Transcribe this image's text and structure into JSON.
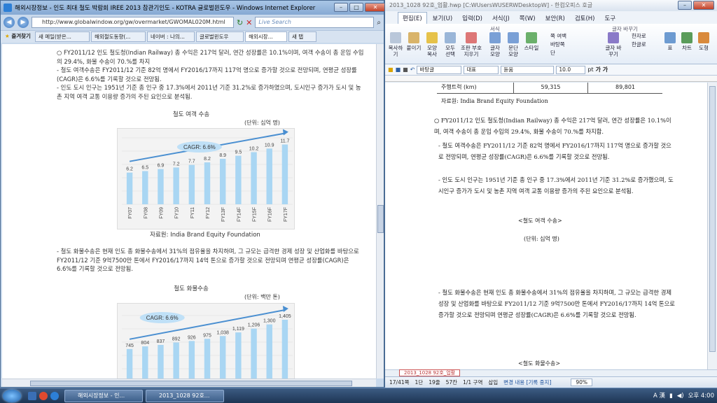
{
  "ie": {
    "title": "해외시장정보 - 인도 최대 철도 박람회 IREE 2013 참관기인도 - KOTRA 글로벌윈도우 - Windows Internet Explorer",
    "url": "http://www.globalwindow.org/gw/overmarket/GWOMAL020M.html",
    "search_placeholder": "Live Search",
    "favorites_label": "즐겨찾기",
    "tabs": [
      "새 메일(받은...",
      "해외철도동향(...",
      "네이버 : 나의...",
      "글로벌윈도우",
      "해외시장...",
      "새 탭"
    ],
    "content": {
      "bullet1": "○ FY2011/12 인도 철도청(Indian Railway) 총 수익은 217억 달러, 연간 성장률은 10.1%이며, 여객 수송이 총 운임 수입의 29.4%, 화물 수송이 70.%를 차지",
      "dash1": "- 철도 여객수송은 FY2011/12 기준 82억 명에서 FY2016/17까지 117억 명으로 증가할 것으로 전망되며, 연평균 성장률(CAGR)은 6.6%를 기록할 것으로 전망됨.",
      "dash2": "- 인도 도시 인구는 1951년 기준 총 인구 중 17.3%에서 2011년 기준 31.2%로 증가하였으며, 도시인구 증가가 도시 및 농촌 지역 여객 교통 이용량 증가의 주된 요인으로 분석됨.",
      "chart1_title": "철도 여객 수송",
      "chart1_unit": "(단위: 십억 명)",
      "chart1_source": "자료원: India Brand Equity Foundation",
      "dash3": "- 철도 화물수송은 현재 인도 총 화물수송에서 31%의 점유율을 차지하며, 그 규모는 급격한 경제 성장 및 산업화를 바탕으로 FY2011/12 기준 9억7500만 톤에서 FY2016/17까지 14억 톤으로 증가할 것으로 전망되며 연평균 성장률(CAGR)은 6.6%를 기록할 것으로 전망됨.",
      "chart2_title": "철도 화물수송",
      "chart2_unit": "(단위: 백만 톤)"
    }
  },
  "chart_data": [
    {
      "type": "bar",
      "title": "철도 여객 수송",
      "ylabel": "(단위: 십억 명)",
      "annotation": "CAGR: 6.6%",
      "categories": [
        "FY07",
        "FY08",
        "FY09",
        "FY10",
        "FY11",
        "FY12",
        "FY13F",
        "FY14F",
        "FY15F",
        "FY16F",
        "FY17F"
      ],
      "values": [
        6.2,
        6.5,
        6.9,
        7.2,
        7.7,
        8.2,
        8.9,
        9.5,
        10.2,
        10.9,
        11.7
      ],
      "labels": [
        "6.2",
        "6.5",
        "6.9",
        "7.2",
        "7.7",
        "8.2",
        "8.9",
        "9.5",
        "10.2",
        "10.9",
        "11.7"
      ],
      "ylim": [
        0,
        13
      ]
    },
    {
      "type": "bar",
      "title": "철도 화물수송",
      "ylabel": "(단위: 백만 톤)",
      "annotation": "CAGR: 6.6%",
      "values": [
        745,
        804,
        837,
        892,
        926,
        975,
        1038,
        1119,
        1206,
        1300,
        1405
      ],
      "labels": [
        "745",
        "804",
        "837",
        "892",
        "926",
        "975",
        "1,038",
        "1,119",
        "1,206",
        "1,300",
        "1,405"
      ],
      "ylim": [
        0,
        1500
      ]
    }
  ],
  "hwp": {
    "title": "2013_1028 92호_업활.hwp [C:WUsersWUSERWDesktopW] - 한컴오피스 호글",
    "tabs": [
      "편집(E)",
      "보기(U)",
      "입력(D)",
      "서식(J)",
      "쪽(W)",
      "보안(R)",
      "검토(H)",
      "도구"
    ],
    "ribbon_buttons": [
      "복사하기",
      "붙이기",
      "모양 복사",
      "모두 선택",
      "조판 부호 지우기",
      "글자 모양",
      "문단 모양",
      "스타일",
      "쪽 여백",
      "바탕쪽",
      "단",
      "글자 바꾸기",
      "한자로",
      "한글로",
      "표",
      "차트",
      "도형"
    ],
    "ribbon_group_labels": [
      "서식",
      "글자 바꾸기"
    ],
    "font_style": "바탕글",
    "font_lang": "대표",
    "font_name": "돋움",
    "font_size": "10.0",
    "font_unit": "pt",
    "format_glyphs": "가 가",
    "table_row": {
      "label": "주행트럭 (km)",
      "v1": "59,315",
      "v2": "89,801"
    },
    "source": "자료원: India Brand Equity Foundation",
    "p1": "○ FY2011/12 인도 철도청(Indian Railway) 총 수익은 217억 달러, 연간 성장률은 10.1%이며, 여객 수송이 총 운임 수입의 29.4%, 화물 수송이 70.%를 차지함.",
    "p2": "- 철도 여객수송은 FY2011/12 기준 82억 명에서 FY2016/17까지 117억 명으로 증가할 것으로 전망되며, 연평균 성장률(CAGR)은 6.6%를 기록할 것으로 전망됨.",
    "p3": "- 인도 도시 인구는 1951년 기준 총 인구 중 17.3%에서 2011년 기준 31.2%로 증가했으며, 도시인구 증가가 도시 및 농촌 지역 여객 교통 이용량 증가의 주된 요인으로 분석됨.",
    "caption1": "<철도 여객 수송>",
    "unit1": "(단위: 십억 명)",
    "p4": "- 철도 화물수송은 현재 인도 총 화물수송에서 31%의 점유율을 차지하며, 그 규모는 급격한 경제 성장 및 산업화를 바탕으로 FY2011/12 기준 9억7500만 톤에서 FY2016/17까지 14억 톤으로 증가할 것으로 전망되며 연평균 성장률(CAGR)은 6.6%를 기록할 것으로 전망됨.",
    "caption2": "<철도 화물수송>",
    "doc_tab": "2013_1028 92호_업활",
    "status": [
      "17/41쪽",
      "1단",
      "19줄",
      "57칸",
      "1/1 구역",
      "삽입",
      "변경 내용 [기록 중지]"
    ],
    "zoom": "90%"
  },
  "taskbar": {
    "tasks": [
      "해외시장정보 - 인...",
      "2013_1028 92호..."
    ],
    "clock": "오후 4:00",
    "ime": "A 漢"
  }
}
